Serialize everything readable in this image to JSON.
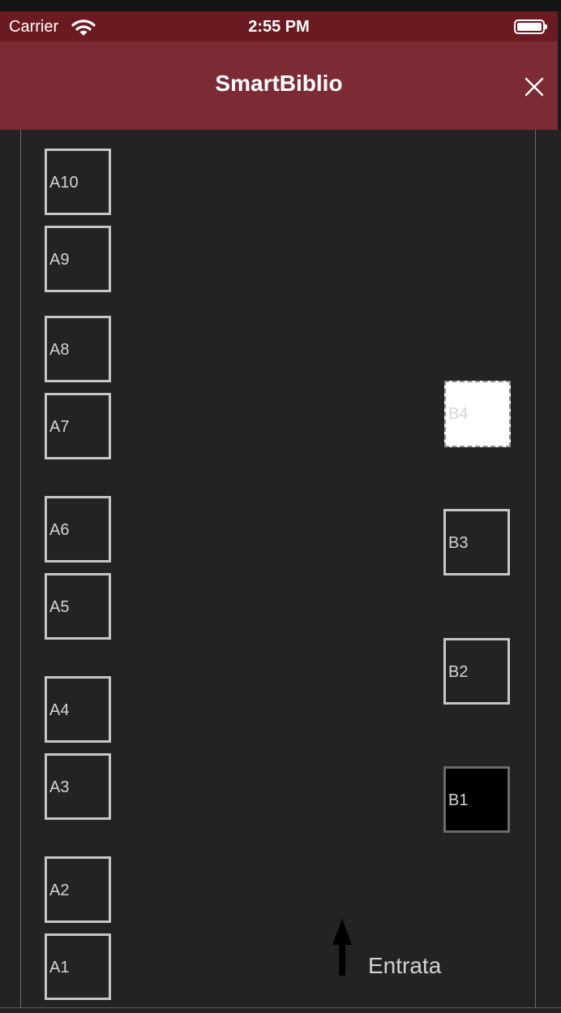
{
  "status_bar": {
    "carrier": "Carrier",
    "time": "2:55 PM",
    "icons": [
      "wifi-icon",
      "battery-icon"
    ]
  },
  "nav_bar": {
    "title": "SmartBiblio",
    "close_icon": "close-icon"
  },
  "map": {
    "seats_a": [
      {
        "id": "A10",
        "state": "available"
      },
      {
        "id": "A9",
        "state": "available"
      },
      {
        "id": "A8",
        "state": "available"
      },
      {
        "id": "A7",
        "state": "available"
      },
      {
        "id": "A6",
        "state": "available"
      },
      {
        "id": "A5",
        "state": "available"
      },
      {
        "id": "A4",
        "state": "available"
      },
      {
        "id": "A3",
        "state": "available"
      },
      {
        "id": "A2",
        "state": "available"
      },
      {
        "id": "A1",
        "state": "available"
      }
    ],
    "seats_b": [
      {
        "id": "B4",
        "state": "selected"
      },
      {
        "id": "B3",
        "state": "available"
      },
      {
        "id": "B2",
        "state": "available"
      },
      {
        "id": "B1",
        "state": "occupied"
      }
    ],
    "entrance": {
      "label": "Entrata",
      "icon": "arrow-up-icon"
    }
  },
  "colors": {
    "status_bar": "#6b1a21",
    "nav_bar": "#7c2b35",
    "background": "#232323",
    "seat_border": "#c6c6c6",
    "seat_selected": "#ffffff",
    "seat_occupied": "#000000"
  }
}
